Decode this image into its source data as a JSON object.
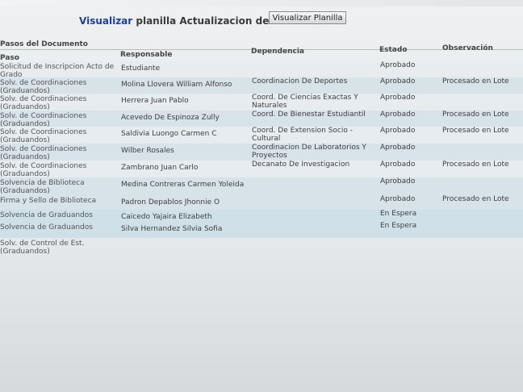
{
  "header": {
    "title_accent": "Visualizar",
    "title_rest": " planilla Actualizacion de datos",
    "button_label": "Visualizar Planilla"
  },
  "section_label": "Pasos del Documento",
  "columns": {
    "paso": "Paso",
    "responsable": "Responsable",
    "dependencia": "Dependencia",
    "estado": "Estado",
    "observacion": "Observación"
  },
  "rows": [
    {
      "paso": "Solicitud de Inscripcion Acto de Grado",
      "responsable": "Estudiante",
      "dependencia": "",
      "estado": "Aprobado",
      "observacion": ""
    },
    {
      "paso": "Solv. de Coordinaciones (Graduandos)",
      "responsable": "Molina Llovera William Alfonso",
      "dependencia": "Coordinacion De Deportes",
      "estado": "Aprobado",
      "observacion": "Procesado en Lote"
    },
    {
      "paso": "Solv. de Coordinaciones (Graduandos)",
      "responsable": "Herrera Juan Pablo",
      "dependencia": "Coord. De Ciencias Exactas Y Naturales",
      "estado": "Aprobado",
      "observacion": ""
    },
    {
      "paso": "Solv. de Coordinaciones (Graduandos)",
      "responsable": "Acevedo De Espinoza Zully",
      "dependencia": "Coord. De Bienestar Estudiantil",
      "estado": "Aprobado",
      "observacion": "Procesado en Lote"
    },
    {
      "paso": "Solv. de Coordinaciones (Graduandos)",
      "responsable": "Saldivia Luongo Carmen C",
      "dependencia": "Coord. De Extension Socio - Cultural",
      "estado": "Aprobado",
      "observacion": "Procesado en Lote"
    },
    {
      "paso": "Solv. de Coordinaciones (Graduandos)",
      "responsable": "Wilber Rosales",
      "dependencia": "Coordinacion De Laboratorios Y Proyectos",
      "estado": "Aprobado",
      "observacion": ""
    },
    {
      "paso": "Solv. de Coordinaciones (Graduandos)",
      "responsable": "Zambrano Juan Carlo",
      "dependencia": "Decanato De Investigacion",
      "estado": "Aprobado",
      "observacion": "Procesado en Lote"
    },
    {
      "paso": "Solvencia de Biblioteca (Graduandos)",
      "responsable": "Medina Contreras Carmen Yoleida",
      "dependencia": "",
      "estado": "Aprobado",
      "observacion": ""
    },
    {
      "paso": "Firma y Sello de Biblioteca",
      "responsable": "Padron Depablos Jhonnie O",
      "dependencia": "",
      "estado": "Aprobado",
      "observacion": "Procesado en Lote"
    },
    {
      "paso": "Solvencia de Graduandos",
      "responsable": "Caicedo Yajaira Elizabeth",
      "dependencia": "",
      "estado": "En Espera",
      "observacion": ""
    },
    {
      "paso": "Solvencia de Graduandos",
      "responsable": "Silva Hernandez Silvia Sofia",
      "dependencia": "",
      "estado": "En Espera",
      "observacion": ""
    },
    {
      "paso": "Solv. de Control de Est. (Graduandos)",
      "responsable": "",
      "dependencia": "",
      "estado": "",
      "observacion": ""
    }
  ]
}
